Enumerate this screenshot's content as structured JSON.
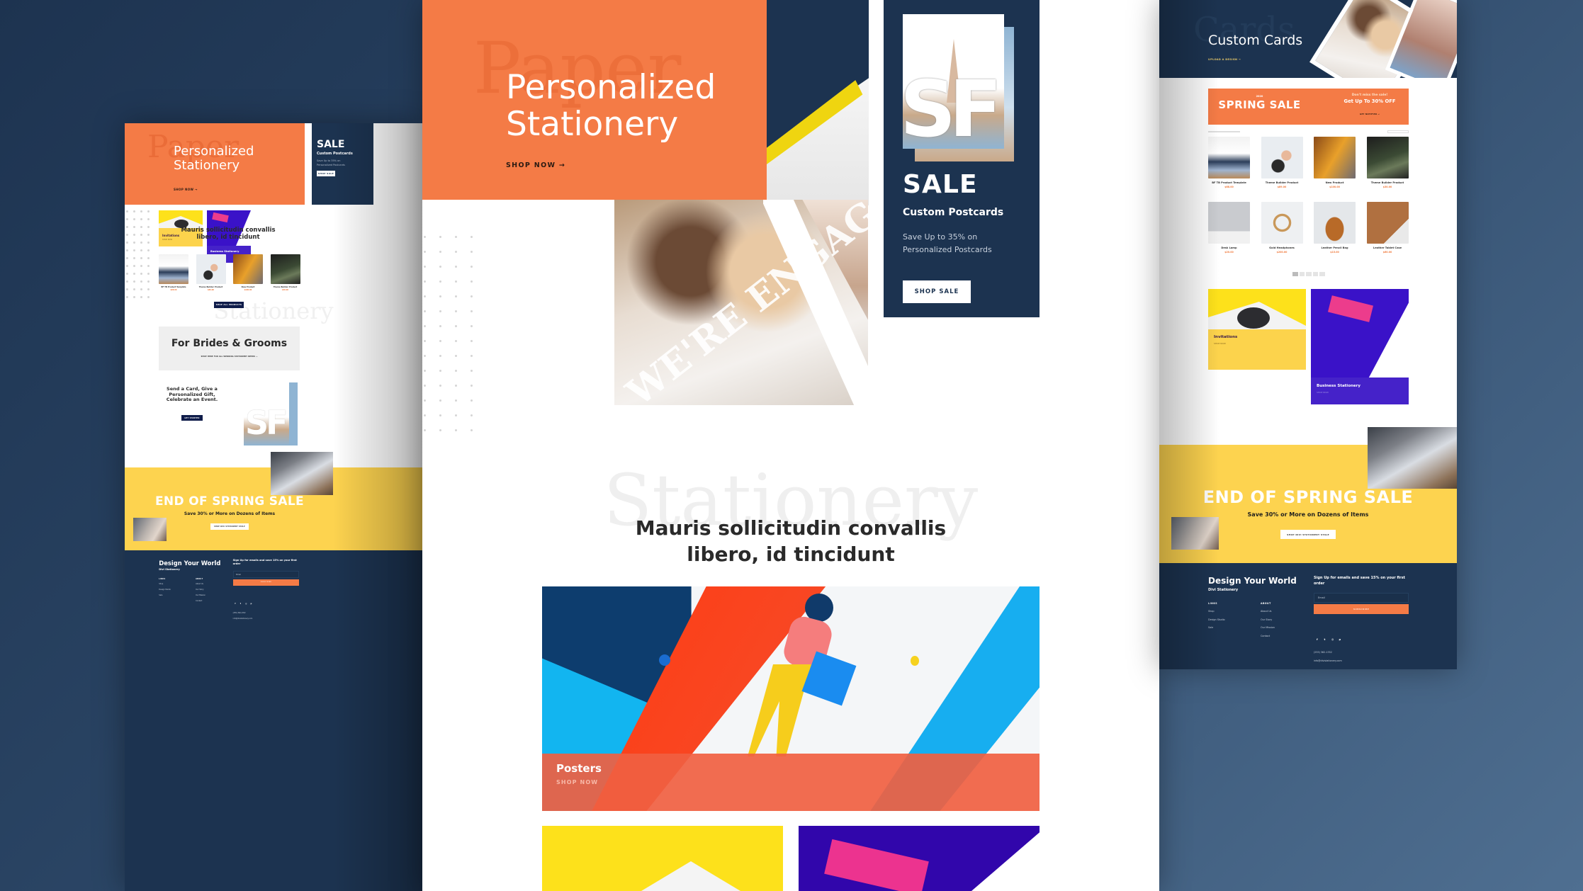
{
  "colors": {
    "orange": "#f47b46",
    "navy": "#1c3350",
    "yellow": "#fdd34f",
    "purple": "#3a12c8",
    "bright_yellow": "#fde11b"
  },
  "left": {
    "hero": {
      "ghost": "Paper",
      "title_line1": "Personalized",
      "title_line2": "Stationery",
      "cta": "SHOP NOW →"
    },
    "sale": {
      "title": "SALE",
      "subtitle": "Custom Postcards",
      "desc": "Save Up to 35% on Personalized Postcards",
      "button": "SHOP SALE"
    },
    "tiles": [
      {
        "title": "Invitations",
        "cta": "SHOP NOW"
      },
      {
        "title": "Business Stationery",
        "cta": "SHOP NOW"
      }
    ],
    "ghost": "Stationery",
    "heading_line1": "Mauris sollicitudin convallis",
    "heading_line2": "libero, id tincidunt",
    "products": [
      {
        "name": "BF TB Product Template",
        "price": "$68.00"
      },
      {
        "name": "Theme Builder Product",
        "price": "$89.00"
      },
      {
        "name": "New Product",
        "price": "$100.00"
      },
      {
        "name": "Theme Builder Product",
        "price": "$30.00"
      }
    ],
    "shop_all": "SHOP ALL PRODUCTS",
    "brides": {
      "title": "For Brides & Grooms",
      "link": "SHOP HERE FOR ALL WEDDING STATIONERY NEEDS →"
    },
    "send": {
      "line1": "Send a Card, Give a",
      "line2": "Personalized Gift,",
      "line3": "Celebrate an Event.",
      "button": "GET STARTED",
      "sf": "SF"
    }
  },
  "middle": {
    "hero": {
      "ghost": "Paper",
      "title_line1": "Personalized",
      "title_line2": "Stationery",
      "cta": "SHOP NOW →"
    },
    "photo_text": "WE'RE ENGAGED",
    "sale": {
      "title": "SALE",
      "subtitle": "Custom Postcards",
      "desc": "Save Up to 35% on Personalized Postcards",
      "button": "SHOP SALE",
      "sf": "SF"
    },
    "ghost": "Stationery",
    "heading_line1": "Mauris sollicitudin convallis",
    "heading_line2": "libero, id tincidunt",
    "poster": {
      "title": "Posters",
      "cta": "SHOP NOW"
    }
  },
  "right": {
    "header": {
      "ghost": "Cards",
      "title": "Custom Cards",
      "cta": "UPLOAD A DESIGN →"
    },
    "banner": {
      "year": "2020",
      "title": "SPRING SALE",
      "tagline": "Don't miss the sale!",
      "offer": "Get Up To 30% OFF",
      "cta": "GET NOTIFIED →"
    },
    "products": [
      {
        "name": "BF TB Product Template",
        "price": "$68.00"
      },
      {
        "name": "Theme Builder Product",
        "price": "$89.00"
      },
      {
        "name": "New Product",
        "price": "$100.00"
      },
      {
        "name": "Theme Builder Product",
        "price": "$30.00"
      },
      {
        "name": "Desk Lamp",
        "price": "$20.00"
      },
      {
        "name": "Gold Headphones",
        "price": "$200.00"
      },
      {
        "name": "Leather Pencil Bag",
        "price": "$15.00"
      },
      {
        "name": "Leather Tablet Case",
        "price": "$60.00"
      }
    ],
    "tiles": [
      {
        "title": "Invitations",
        "cta": "SHOP NOW"
      },
      {
        "title": "Business Stationery",
        "cta": "SHOP NOW"
      }
    ]
  },
  "spring": {
    "title": "END OF SPRING SALE",
    "subtitle": "Save 30% or More on Dozens of Items",
    "button": "SHOP DIVI STATIONERY STALE"
  },
  "footer": {
    "title": "Design Your World",
    "subtitle": "Divi Stationery",
    "links_heading": "LINKS",
    "links": [
      "Shop",
      "Design Studio",
      "Sale"
    ],
    "about_heading": "ABOUT",
    "about": [
      "About Us",
      "Our Story",
      "Our Mission",
      "Contact"
    ],
    "signup": "Sign Up for emails and save 15% on your first order",
    "email_placeholder": "Email",
    "subscribe": "SUBSCRIBE",
    "social": [
      "facebook-icon",
      "twitter-icon",
      "instagram-icon",
      "pinterest-icon"
    ],
    "phone": "(255) 362-1352",
    "email": "info@divistationery.com"
  }
}
